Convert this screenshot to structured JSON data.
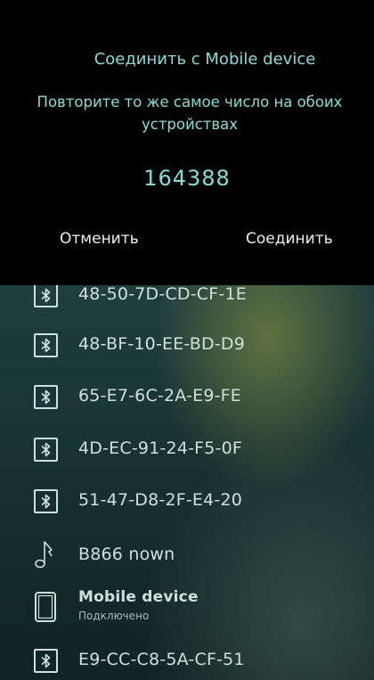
{
  "dialog": {
    "title": "Соединить с  Mobile device",
    "message": "Повторите то же самое число на обоих устройствах",
    "code": "164388",
    "cancel_label": "Отменить",
    "connect_label": "Соединить"
  },
  "devices": [
    {
      "name": "48-50-7D-CD-CF-1E",
      "icon": "bluetooth-icon"
    },
    {
      "name": "48-BF-10-EE-BD-D9",
      "icon": "bluetooth-icon"
    },
    {
      "name": "65-E7-6C-2A-E9-FE",
      "icon": "bluetooth-icon"
    },
    {
      "name": "4D-EC-91-24-F5-0F",
      "icon": "bluetooth-icon"
    },
    {
      "name": "51-47-D8-2F-E4-20",
      "icon": "bluetooth-icon"
    },
    {
      "name": "B866 nown",
      "icon": "music-note-icon"
    },
    {
      "name": "Mobile device",
      "status": "Подключено",
      "icon": "phone-icon"
    },
    {
      "name": "E9-CC-C8-5A-CF-51",
      "icon": "bluetooth-icon"
    }
  ],
  "colors": {
    "dialog_accent": "#7fe0d8",
    "dialog_background": "#000000",
    "list_text": "#cfe0dc"
  }
}
